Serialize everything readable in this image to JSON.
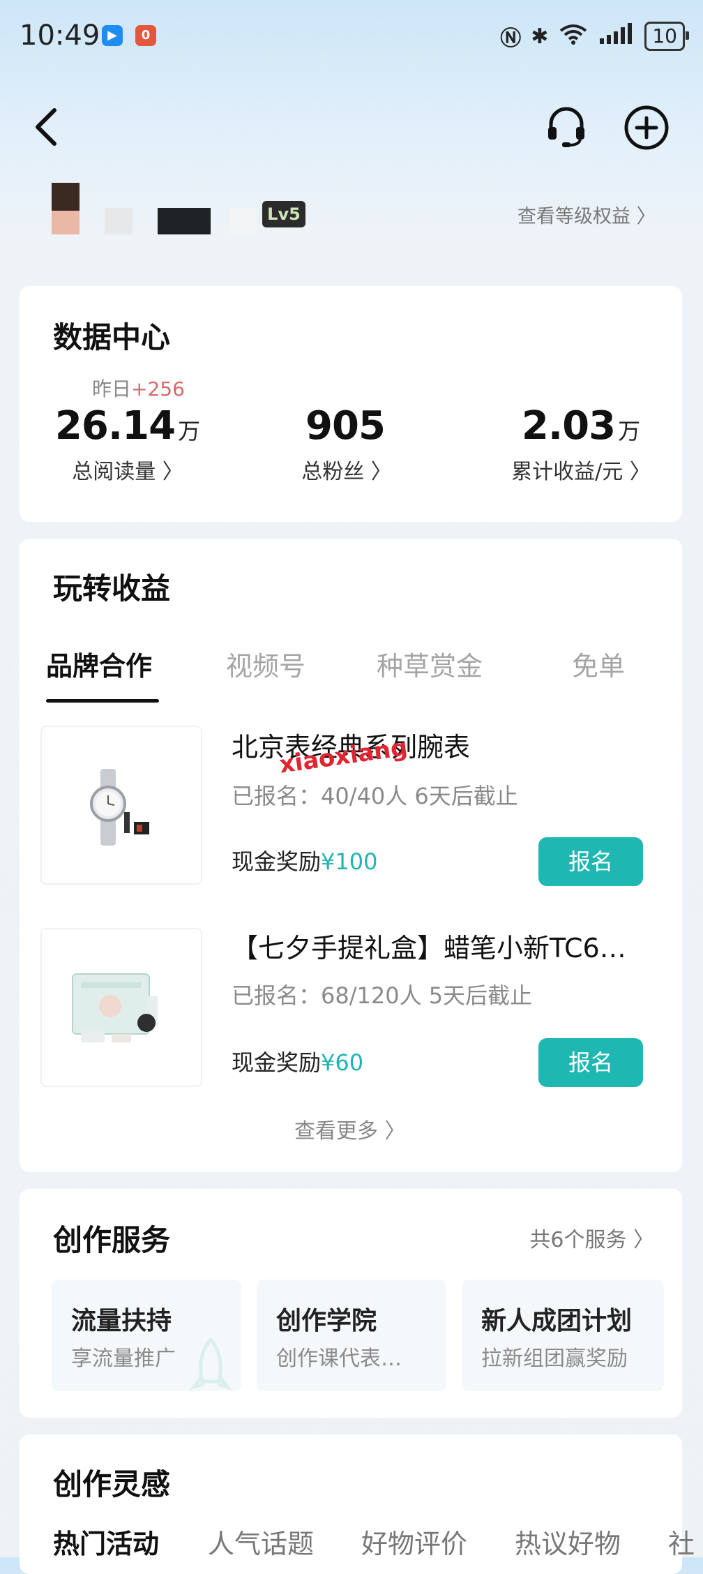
{
  "status_bar": {
    "time": "10:49",
    "app_icon_1": "bilibili-icon",
    "app_icon_2": "notification-icon",
    "battery": "10",
    "network_label": "6"
  },
  "header": {
    "back_icon": "chevron-left-icon",
    "service_icon": "headset-icon",
    "add_icon": "plus-circle-icon"
  },
  "profile": {
    "level": "Lv5",
    "level_link": "查看等级权益"
  },
  "data_center": {
    "title": "数据中心",
    "yesterday_label": "昨日",
    "yesterday_delta": "+256",
    "stats": [
      {
        "value": "26.14",
        "unit": "万",
        "label": "总阅读量 〉"
      },
      {
        "value": "905",
        "unit": "",
        "label": "总粉丝 〉"
      },
      {
        "value": "2.03",
        "unit": "万",
        "label": "累计收益/元 〉"
      }
    ]
  },
  "earnings": {
    "title": "玩转收益",
    "tabs": [
      "品牌合作",
      "视频号",
      "种草赏金",
      "免单"
    ],
    "products": [
      {
        "title": "北京表经典系列腕表",
        "meta": "已报名：40/40人   6天后截止",
        "reward_label": "现金奖励",
        "reward_amount": "¥100",
        "button": "报名"
      },
      {
        "title": "【七夕手提礼盒】蜡笔小新TC6…",
        "meta": "已报名：68/120人   5天后截止",
        "reward_label": "现金奖励",
        "reward_amount": "¥60",
        "button": "报名"
      }
    ],
    "more": "查看更多 〉"
  },
  "watermark": "xiaoxiang",
  "creation_services": {
    "title": "创作服务",
    "link": "共6个服务 〉",
    "tiles": [
      {
        "title": "流量扶持",
        "subtitle": "享流量推广"
      },
      {
        "title": "创作学院",
        "subtitle": "创作课代表…"
      },
      {
        "title": "新人成团计划",
        "subtitle": "拉新组团赢奖励"
      }
    ]
  },
  "inspiration": {
    "title": "创作灵感",
    "tabs": [
      "热门活动",
      "人气话题",
      "好物评价",
      "热议好物",
      "社"
    ]
  },
  "colors": {
    "accent": "#1fb7b2",
    "delta": "#d46a6a"
  }
}
